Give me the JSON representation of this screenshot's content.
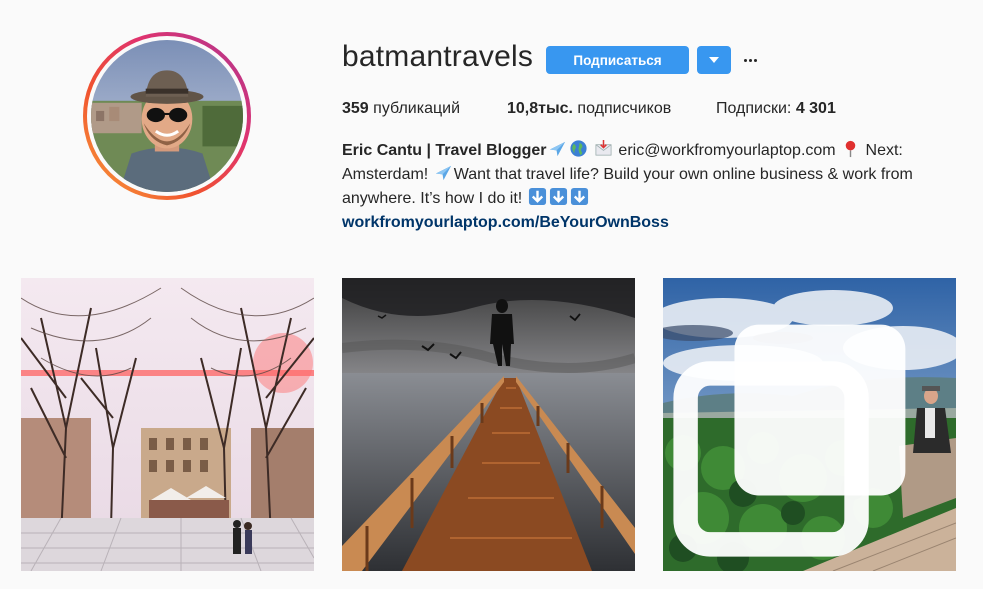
{
  "profile": {
    "username": "batmantravels",
    "follow_label": "Подписаться",
    "avatar_name": "avatar",
    "stats": {
      "posts_count": "359",
      "posts_label": " публикаций",
      "followers_count": "10,8тыс.",
      "followers_label": " подписчиков",
      "following_label": "Подписки: ",
      "following_count": "4 301"
    },
    "bio": {
      "name": "Eric Cantu | Travel Blogger",
      "line1_email": " eric@workfromyourlaptop.com ",
      "line1_next": " Next:",
      "line2_a": "Amsterdam! ",
      "line2_b": "Want that travel life? Build your own online business & work from",
      "line3": "anywhere. It’s how I do it! ",
      "link": "workfromyourlaptop.com/BeYourOwnBoss"
    }
  },
  "icons": {
    "airplane": "airplane-icon",
    "globe": "globe-icon",
    "envelope": "envelope-icon",
    "pin": "pin-icon",
    "down_arrow": "down-arrow-icon",
    "dropdown": "chevron-down-icon",
    "more": "more-icon",
    "carousel": "carousel-icon"
  },
  "colors": {
    "accent": "#3897f0",
    "link": "#003569",
    "text": "#262626",
    "background": "#fafafa"
  },
  "posts": [
    {
      "name": "post-tree-lined-plaza"
    },
    {
      "name": "post-pier-levitation"
    },
    {
      "name": "post-forest-overlook",
      "multi": true
    }
  ]
}
